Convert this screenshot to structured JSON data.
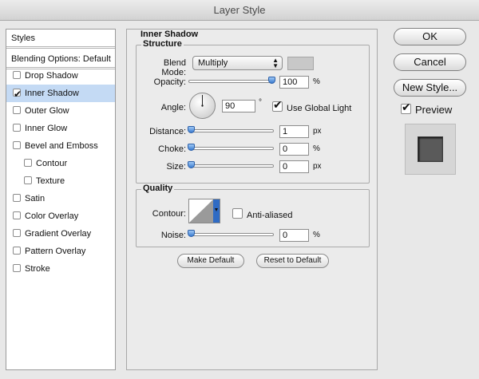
{
  "window": {
    "title": "Layer Style"
  },
  "styles_list": {
    "header": "Styles",
    "blending_options": "Blending Options: Default",
    "items": [
      {
        "label": "Drop Shadow",
        "checked": false,
        "selected": false,
        "indent": false
      },
      {
        "label": "Inner Shadow",
        "checked": true,
        "selected": true,
        "indent": false
      },
      {
        "label": "Outer Glow",
        "checked": false,
        "selected": false,
        "indent": false
      },
      {
        "label": "Inner Glow",
        "checked": false,
        "selected": false,
        "indent": false
      },
      {
        "label": "Bevel and Emboss",
        "checked": false,
        "selected": false,
        "indent": false
      },
      {
        "label": "Contour",
        "checked": false,
        "selected": false,
        "indent": true
      },
      {
        "label": "Texture",
        "checked": false,
        "selected": false,
        "indent": true
      },
      {
        "label": "Satin",
        "checked": false,
        "selected": false,
        "indent": false
      },
      {
        "label": "Color Overlay",
        "checked": false,
        "selected": false,
        "indent": false
      },
      {
        "label": "Gradient Overlay",
        "checked": false,
        "selected": false,
        "indent": false
      },
      {
        "label": "Pattern Overlay",
        "checked": false,
        "selected": false,
        "indent": false
      },
      {
        "label": "Stroke",
        "checked": false,
        "selected": false,
        "indent": false
      }
    ]
  },
  "panel": {
    "title": "Inner Shadow",
    "structure": {
      "label": "Structure",
      "blend_mode_label": "Blend Mode:",
      "blend_mode_value": "Multiply",
      "swatch_color": "#c8c8c8",
      "opacity_label": "Opacity:",
      "opacity_value": "100",
      "opacity_unit": "%",
      "angle_label": "Angle:",
      "angle_value": "90",
      "angle_unit": "°",
      "use_global_light_label": "Use Global Light",
      "use_global_light": true,
      "distance_label": "Distance:",
      "distance_value": "1",
      "distance_unit": "px",
      "choke_label": "Choke:",
      "choke_value": "0",
      "choke_unit": "%",
      "size_label": "Size:",
      "size_value": "0",
      "size_unit": "px"
    },
    "quality": {
      "label": "Quality",
      "contour_label": "Contour:",
      "anti_aliased_label": "Anti-aliased",
      "anti_aliased": false,
      "noise_label": "Noise:",
      "noise_value": "0",
      "noise_unit": "%"
    },
    "make_default_label": "Make Default",
    "reset_default_label": "Reset to Default"
  },
  "actions": {
    "ok_label": "OK",
    "cancel_label": "Cancel",
    "new_style_label": "New Style...",
    "preview_label": "Preview",
    "preview_checked": true
  },
  "colors": {
    "selection": "#c4daf4",
    "slider_thumb": "#3a7bd0",
    "preview_fill": "#5a5a5a"
  }
}
